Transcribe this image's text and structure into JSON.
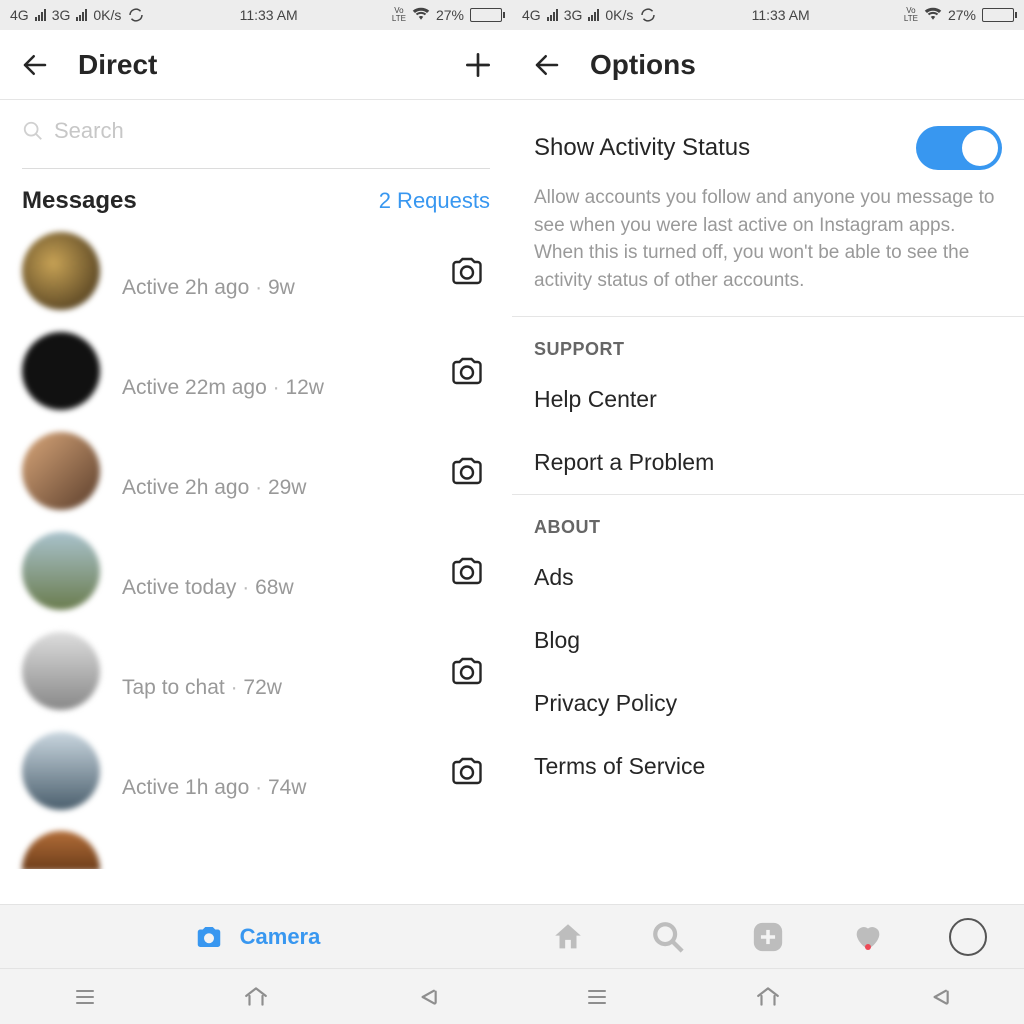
{
  "status": {
    "net1": "4G",
    "net2": "3G",
    "speed": "0K/s",
    "time": "11:33 AM",
    "lte": "VoLTE",
    "battery_pct": "27%"
  },
  "direct": {
    "title": "Direct",
    "search_placeholder": "Search",
    "messages_heading": "Messages",
    "requests": "2 Requests",
    "camera_label": "Camera",
    "rows": [
      {
        "status": "Active 2h ago",
        "age": "9w"
      },
      {
        "status": "Active 22m ago",
        "age": "12w"
      },
      {
        "status": "Active 2h ago",
        "age": "29w"
      },
      {
        "status": "Active today",
        "age": "68w"
      },
      {
        "status": "Tap to chat",
        "age": "72w"
      },
      {
        "status": "Active 1h ago",
        "age": "74w"
      }
    ]
  },
  "options": {
    "title": "Options",
    "activity_label": "Show Activity Status",
    "activity_on": true,
    "activity_desc": "Allow accounts you follow and anyone you message to see when you were last active on Instagram apps. When this is turned off, you won't be able to see the activity status of other accounts.",
    "support_heading": "SUPPORT",
    "support_items": [
      "Help Center",
      "Report a Problem"
    ],
    "about_heading": "ABOUT",
    "about_items": [
      "Ads",
      "Blog",
      "Privacy Policy",
      "Terms of Service"
    ]
  }
}
